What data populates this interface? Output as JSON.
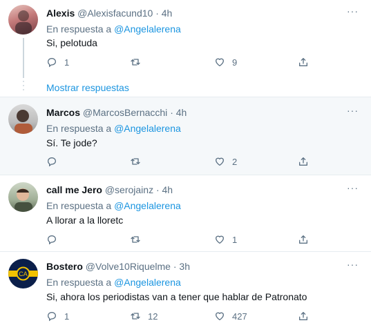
{
  "tweets": [
    {
      "name": "Alexis",
      "handle": "@Alexisfacund10",
      "time": "· 4h",
      "reply_prefix": "En respuesta a",
      "reply_to": "@Angelalerena",
      "text": "Si, pelotuda",
      "replies": "1",
      "retweets": "",
      "likes": "9"
    },
    {
      "name": "Marcos",
      "handle": "@MarcosBernacchi",
      "time": "· 4h",
      "reply_prefix": "En respuesta a",
      "reply_to": "@Angelalerena",
      "text": "Sí. Te jode?",
      "replies": "",
      "retweets": "",
      "likes": "2"
    },
    {
      "name": "call me Jero",
      "handle": "@serojainz",
      "time": "· 4h",
      "reply_prefix": "En respuesta a",
      "reply_to": "@Angelalerena",
      "text": "A llorar a la lloretc",
      "replies": "",
      "retweets": "",
      "likes": "1"
    },
    {
      "name": "Bostero",
      "handle": "@Volve10Riquelme",
      "time": "· 3h",
      "reply_prefix": "En respuesta a",
      "reply_to": "@Angelalerena",
      "text": "Si, ahora los periodistas van a tener que hablar de Patronato",
      "replies": "1",
      "retweets": "12",
      "likes": "427"
    }
  ],
  "show_replies_label": "Mostrar respuestas",
  "more_glyph": "···",
  "icons": {
    "reply": "reply-icon",
    "retweet": "retweet-icon",
    "like": "heart-icon",
    "share": "share-icon",
    "more": "more-icon"
  },
  "colors": {
    "link": "#1b95e0",
    "secondary": "#5b7083",
    "hover_background": "#f5f8fa",
    "divider": "#e6ecf0"
  }
}
